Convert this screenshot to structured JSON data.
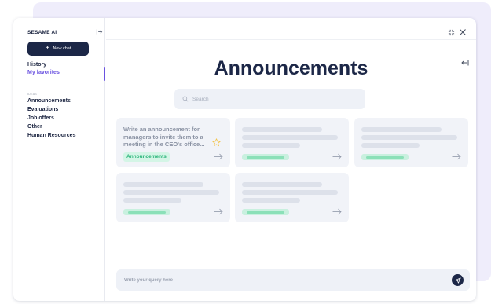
{
  "sidebar": {
    "brand": "SESAME AI",
    "new_chat_label": "New chat",
    "nav_top": [
      "History",
      "My favorites"
    ],
    "section_label": "IDEAS",
    "nav_ideas": [
      "Announcements",
      "Evaluations",
      "Job offers",
      "Other",
      "Human Resources"
    ]
  },
  "main": {
    "title": "Announcements",
    "search_placeholder": "Search",
    "card1": {
      "text": "Write an announcement for managers to invite them to a meeting in the CEO's office...",
      "tag": "Announcements"
    },
    "query_placeholder": "Write your query here"
  },
  "colors": {
    "navy": "#1c2747",
    "accent_purple": "#6a52e0",
    "tag_green": "#2bb57a",
    "star": "#f3c44b"
  },
  "icons": [
    "collapse-sidebar-icon",
    "plus-icon",
    "expand-icon",
    "close-icon",
    "back-arrow-icon",
    "search-icon",
    "star-icon",
    "arrow-right-icon",
    "send-icon"
  ]
}
